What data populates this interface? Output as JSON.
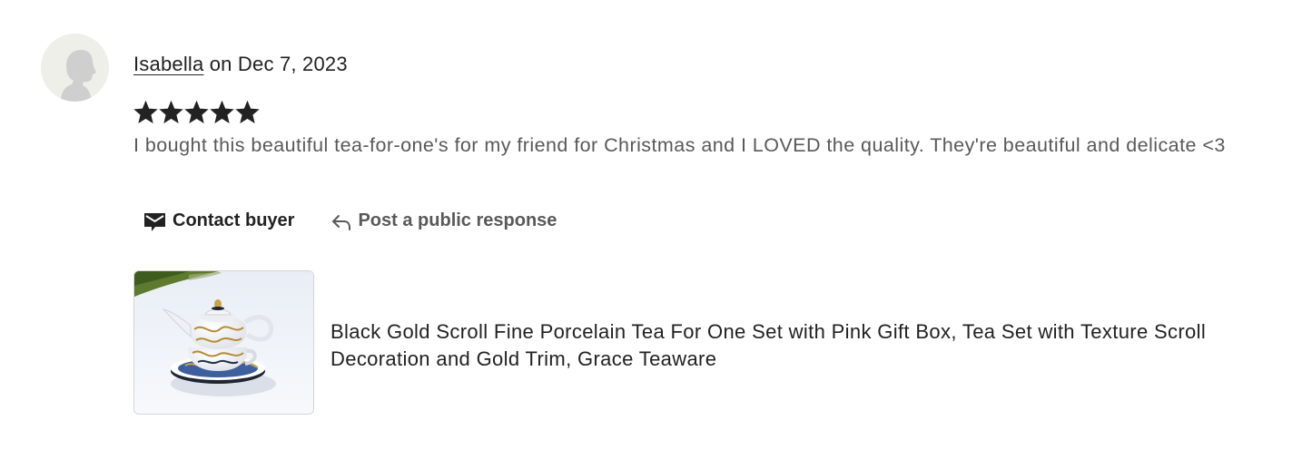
{
  "review": {
    "reviewer_name": "Isabella",
    "date_text": " on Dec 7, 2023",
    "rating": 5,
    "rating_max": 5,
    "text": "I bought this beautiful tea-for-one's for my friend for Christmas and I LOVED the quality. They're beautiful and delicate <3"
  },
  "actions": {
    "contact_label": "Contact buyer",
    "respond_label": "Post a public response"
  },
  "listing": {
    "title": "Black Gold Scroll Fine Porcelain Tea For One Set with Pink Gift Box, Tea Set with Texture Scroll Decoration and Gold Trim, Grace Teaware"
  },
  "icons": {
    "avatar": "default-user-silhouette-icon",
    "star": "star-filled-icon",
    "contact": "envelope-message-icon",
    "respond": "reply-arrow-icon"
  },
  "colors": {
    "text_primary": "#222222",
    "text_secondary": "#595959",
    "avatar_bg": "#efefe9",
    "avatar_silhouette": "#cfcfcf",
    "star": "#222222",
    "thumb_border": "#d4d4d4"
  }
}
